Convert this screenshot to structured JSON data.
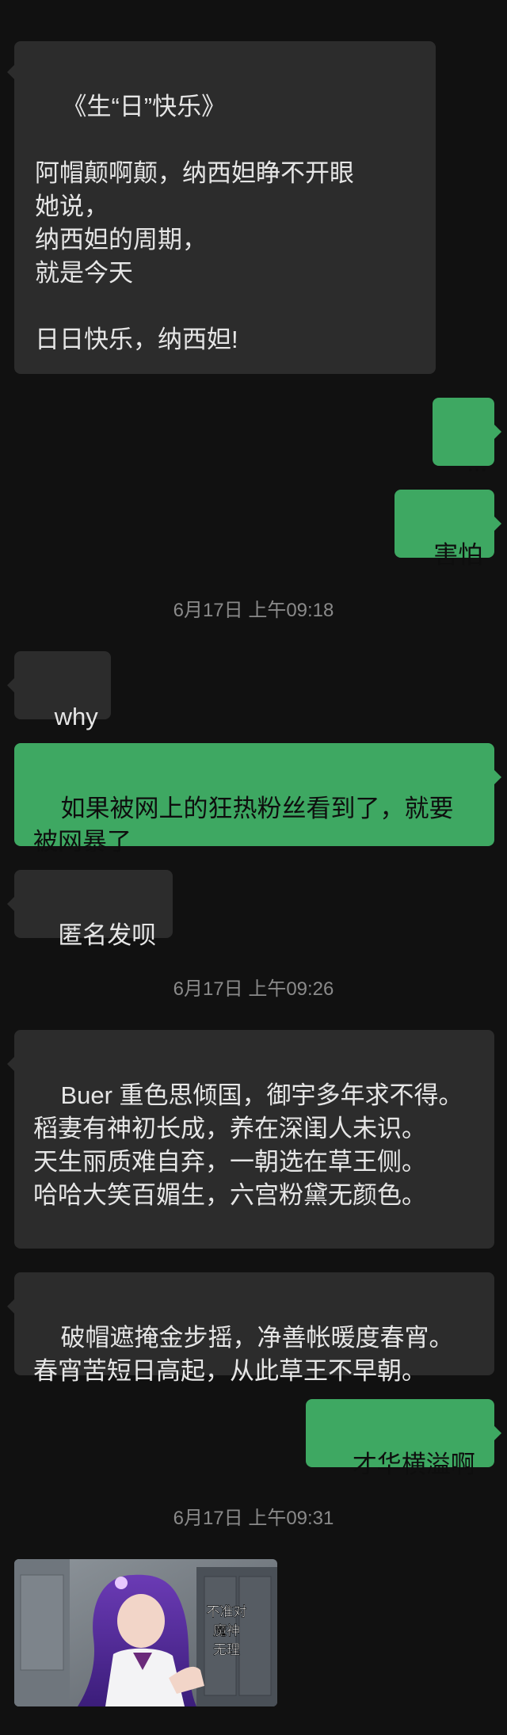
{
  "messages": [
    {
      "type": "in",
      "text": "《生“日”快乐》\n\n阿帽颠啊颠，纳西妲睁不开眼\n她说，\n纳西妲的周期，\n就是今天\n\n日日快乐，纳西妲!"
    },
    {
      "type": "out",
      "text": "..."
    },
    {
      "type": "out",
      "text": "害怕"
    },
    {
      "type": "time",
      "text": "6月17日 上午09:18"
    },
    {
      "type": "in",
      "text": "why"
    },
    {
      "type": "out",
      "text": "如果被网上的狂热粉丝看到了，就要被网暴了"
    },
    {
      "type": "in",
      "text": "匿名发呗"
    },
    {
      "type": "time",
      "text": "6月17日 上午09:26"
    },
    {
      "type": "in",
      "text": "Buer 重色思倾国，御宇多年求不得。稻妻有神初长成，养在深闺人未识。\n天生丽质难自弃，一朝选在草王侧。\n哈哈大笑百媚生，六宫粉黛无颜色。"
    },
    {
      "type": "in",
      "text": "破帽遮掩金步摇，净善帐暖度春宵。\n春宵苦短日高起，从此草王不早朝。"
    },
    {
      "type": "out",
      "text": "才华横溢啊"
    },
    {
      "type": "time",
      "text": "6月17日 上午09:31"
    }
  ],
  "image_message": {
    "caption_lines": [
      "不准对",
      "魔神",
      "无理"
    ]
  }
}
